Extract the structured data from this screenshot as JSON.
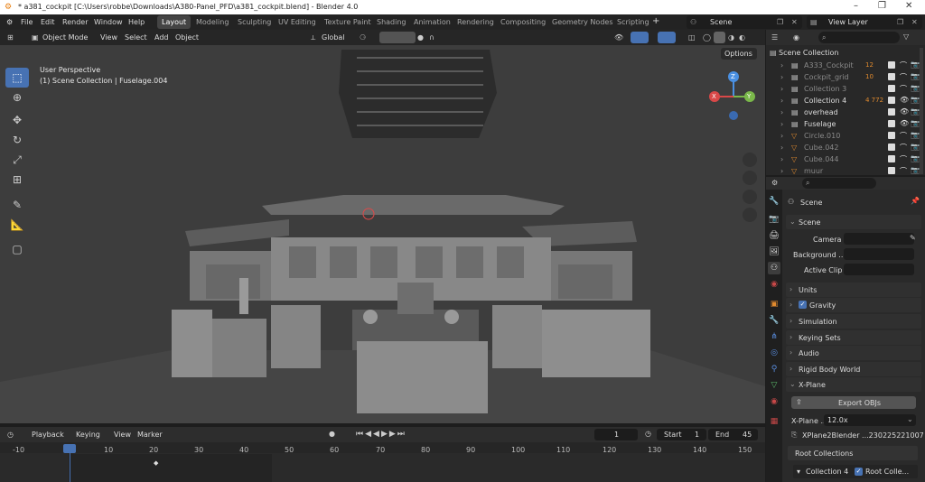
{
  "window": {
    "title": "* a381_cockpit [C:\\Users\\robbe\\Downloads\\A380-Panel_PFD\\a381_cockpit.blend] - Blender 4.0",
    "controls": [
      "–",
      "❐",
      "✕"
    ]
  },
  "menu": [
    "File",
    "Edit",
    "Render",
    "Window",
    "Help"
  ],
  "workspaces": [
    "Layout",
    "Modeling",
    "Sculpting",
    "UV Editing",
    "Texture Paint",
    "Shading",
    "Animation",
    "Rendering",
    "Compositing",
    "Geometry Nodes",
    "Scripting"
  ],
  "scene": "Scene",
  "view_layer": "View Layer",
  "viewport": {
    "mode": "Object Mode",
    "menus": [
      "View",
      "Select",
      "Add",
      "Object"
    ],
    "transform": "Global",
    "perspective": "User Perspective",
    "context": "(1) Scene Collection | Fuselage.004",
    "options": "Options"
  },
  "gizmo": {
    "x": "X",
    "y": "Y",
    "z": "Z"
  },
  "outliner": {
    "search": "",
    "root": "Scene Collection",
    "items": [
      {
        "name": "A333_Cockpit",
        "badge": "12",
        "dim": true
      },
      {
        "name": "Cockpit_grid",
        "badge": "10",
        "dim": true
      },
      {
        "name": "Collection 3",
        "badge": "",
        "dim": true
      },
      {
        "name": "Collection 4",
        "badge": "4  772",
        "dim": false
      },
      {
        "name": "overhead",
        "badge": "",
        "dim": false
      },
      {
        "name": "Fuselage",
        "badge": "",
        "dim": false
      },
      {
        "name": "Circle.010",
        "badge": "",
        "dim": true
      },
      {
        "name": "Cube.042",
        "badge": "",
        "dim": true
      },
      {
        "name": "Cube.044",
        "badge": "",
        "dim": true
      },
      {
        "name": "muur",
        "badge": "",
        "dim": true
      }
    ]
  },
  "properties": {
    "header": "Scene",
    "panel": "Scene",
    "camera_label": "Camera",
    "background_label": "Background ...",
    "active_clip_label": "Active Clip",
    "sections": [
      "Units",
      "Gravity",
      "Simulation",
      "Keying Sets",
      "Audio",
      "Rigid Body World",
      "X-Plane"
    ],
    "export_label": "Export OBJs",
    "xplane_label": "X-Plane ...",
    "xplane_version": "12.0x",
    "xplane_file": "XPlane2Blender ...230225221007",
    "root_collections": "Root Collections",
    "collection4": "Collection 4",
    "root_colle": "Root Colle..."
  },
  "timeline": {
    "menus": [
      "Playback",
      "Keying",
      "View",
      "Marker"
    ],
    "current_frame": "1",
    "start_label": "Start",
    "start": "1",
    "end_label": "End",
    "end": "45",
    "ticks": [
      "-10",
      "1",
      "10",
      "20",
      "30",
      "40",
      "50",
      "60",
      "70",
      "80",
      "90",
      "100",
      "110",
      "120",
      "130",
      "140",
      "150"
    ]
  }
}
